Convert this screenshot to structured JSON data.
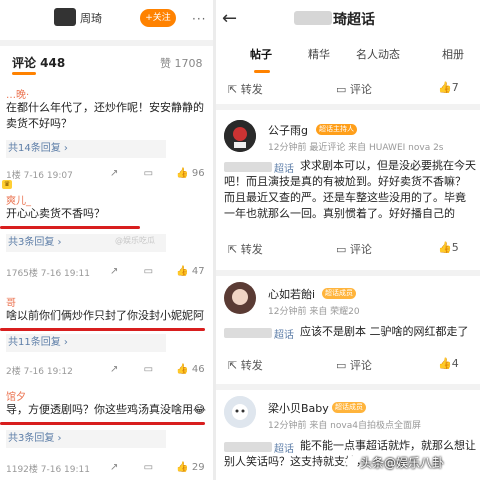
{
  "left": {
    "header": {
      "name": "周琦",
      "follow": "+关注",
      "more": "···"
    },
    "comments_title": "评论 448",
    "likes": "赞 1708",
    "comments": [
      {
        "name": "…晚·",
        "text1": "在都什么年代了，还炒作呢！安安静静的",
        "text2": "卖货不好吗？",
        "reply": "共14条回复 ›",
        "meta": "1楼 7-16 19:07",
        "share": "↗",
        "comment": "▭",
        "likes": "96"
      },
      {
        "name": "爽儿_",
        "text1": "开心心卖货不香吗？",
        "reply": "共3条回复 ›",
        "meta": "1765楼 7-16 19:11",
        "share": "↗",
        "comment": "▭",
        "likes": "47"
      },
      {
        "name": "哥",
        "text1": "啥以前你们俩炒作只封了你没封小妮妮阿",
        "reply": "共11条回复 ›",
        "meta": "2楼 7-16 19:12",
        "share": "↗",
        "comment": "▭",
        "likes": "46"
      },
      {
        "name": "馆夕",
        "text1": "导，方便透剧吗？你这些鸡汤真没啥用😂",
        "reply": "共3条回复 ›",
        "meta": "1192楼 7-16 19:11",
        "share": "↗",
        "comment": "▭",
        "likes": "29"
      }
    ]
  },
  "right": {
    "title": "琦超话",
    "tabs": [
      "帖子",
      "精华",
      "名人动态",
      "相册"
    ],
    "actbar": {
      "repost": "转发",
      "comment": "评论",
      "likes": "7"
    },
    "posts": [
      {
        "name": "公子雨g",
        "badge": "超话主持人",
        "meta": "12分钟前 最近评论 来自 HUAWEI nova 2s",
        "tag": "超话",
        "lines": [
          "求求剧本可以，但是没必要挑在今天",
          "吧！而且演技是真的有被尬到。好好卖货不香嘛？",
          "而且最近又查的严。还是车整这些没用的了。毕竟",
          "一年也就那么一回。真别惯着了。好好播自己的"
        ],
        "repost": "转发",
        "comment": "评论",
        "likes": "5"
      },
      {
        "name": "心如若飴i",
        "badge": "超话成员",
        "meta": "12分钟前 来自 荣耀20",
        "tag": "超话",
        "lines": [
          "应该不是剧本 二驴啥的网红都走了"
        ],
        "repost": "转发",
        "comment": "评论",
        "likes": "4"
      },
      {
        "name": "梁小贝Baby",
        "badge": "超话成员",
        "meta": "12分钟前 来自 nova4自拍极点全面屏",
        "tag": "超话",
        "lines": [
          "能不能一点事超话就炸，就那么想让",
          "别人笑话吗？这支持就支持，"
        ]
      }
    ],
    "watermark": "头条@娱乐八卦",
    "center_watermark": "@娱乐吃瓜"
  },
  "colors": {
    "accent": "#ff8200",
    "name": "#eb7350",
    "link": "#5d7ea8",
    "red_mark": "#d81e1e"
  }
}
